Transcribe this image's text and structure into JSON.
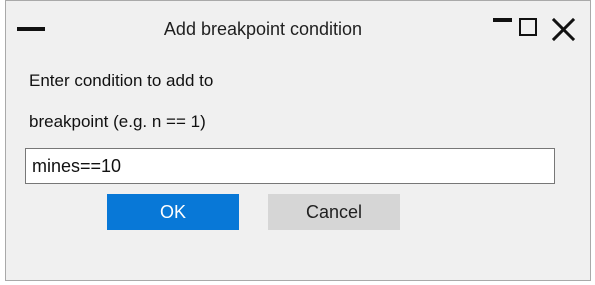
{
  "window": {
    "title": "Add breakpoint condition",
    "menu_icon": "window-menu-icon",
    "controls": {
      "minimize_icon": "minimize-icon",
      "maximize_icon": "maximize-icon",
      "close_icon": "close-icon"
    }
  },
  "dialog": {
    "prompt_line_1": "Enter condition to add to",
    "prompt_line_2": "breakpoint (e.g. n == 1)",
    "condition_value": "mines==10",
    "ok_label": "OK",
    "cancel_label": "Cancel"
  },
  "colors": {
    "ok_button": "#0878d7",
    "cancel_button": "#d6d6d6",
    "window_background": "#f0f0f0"
  }
}
